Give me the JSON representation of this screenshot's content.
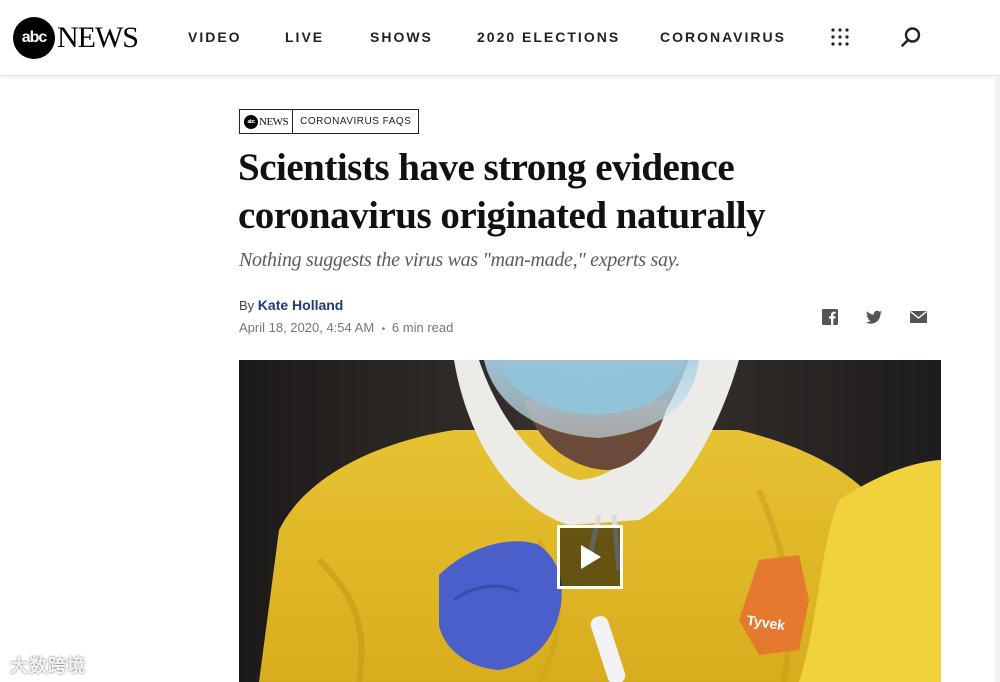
{
  "header": {
    "logo_circle": "abc",
    "logo_word": "NEWS",
    "nav": [
      "VIDEO",
      "LIVE",
      "SHOWS",
      "2020 ELECTIONS",
      "CORONAVIRUS"
    ],
    "icons": [
      "grid-menu-icon",
      "search-icon"
    ]
  },
  "article": {
    "badge": {
      "logo_circle": "abc",
      "logo_word": "NEWS",
      "label": "CORONAVIRUS FAQS"
    },
    "headline_line1": "Scientists have strong evidence",
    "headline_line2": "coronavirus originated naturally",
    "subhead": "Nothing suggests the virus was \"man-made,\" experts say.",
    "by": "By",
    "author": "Kate Holland",
    "date": "April 18, 2020, 4:54 AM",
    "separator": "•",
    "read_time": "6 min read",
    "share_icons": [
      "facebook-icon",
      "twitter-icon",
      "email-icon"
    ]
  },
  "media": {
    "hero_icon": "video-play-icon",
    "watermark": "大数跨境",
    "patch_text": "Tyvek"
  },
  "colors": {
    "author_link": "#1b3b7a",
    "suit_yellow": "#e8c531",
    "glove_blue": "#4a5fc9"
  }
}
